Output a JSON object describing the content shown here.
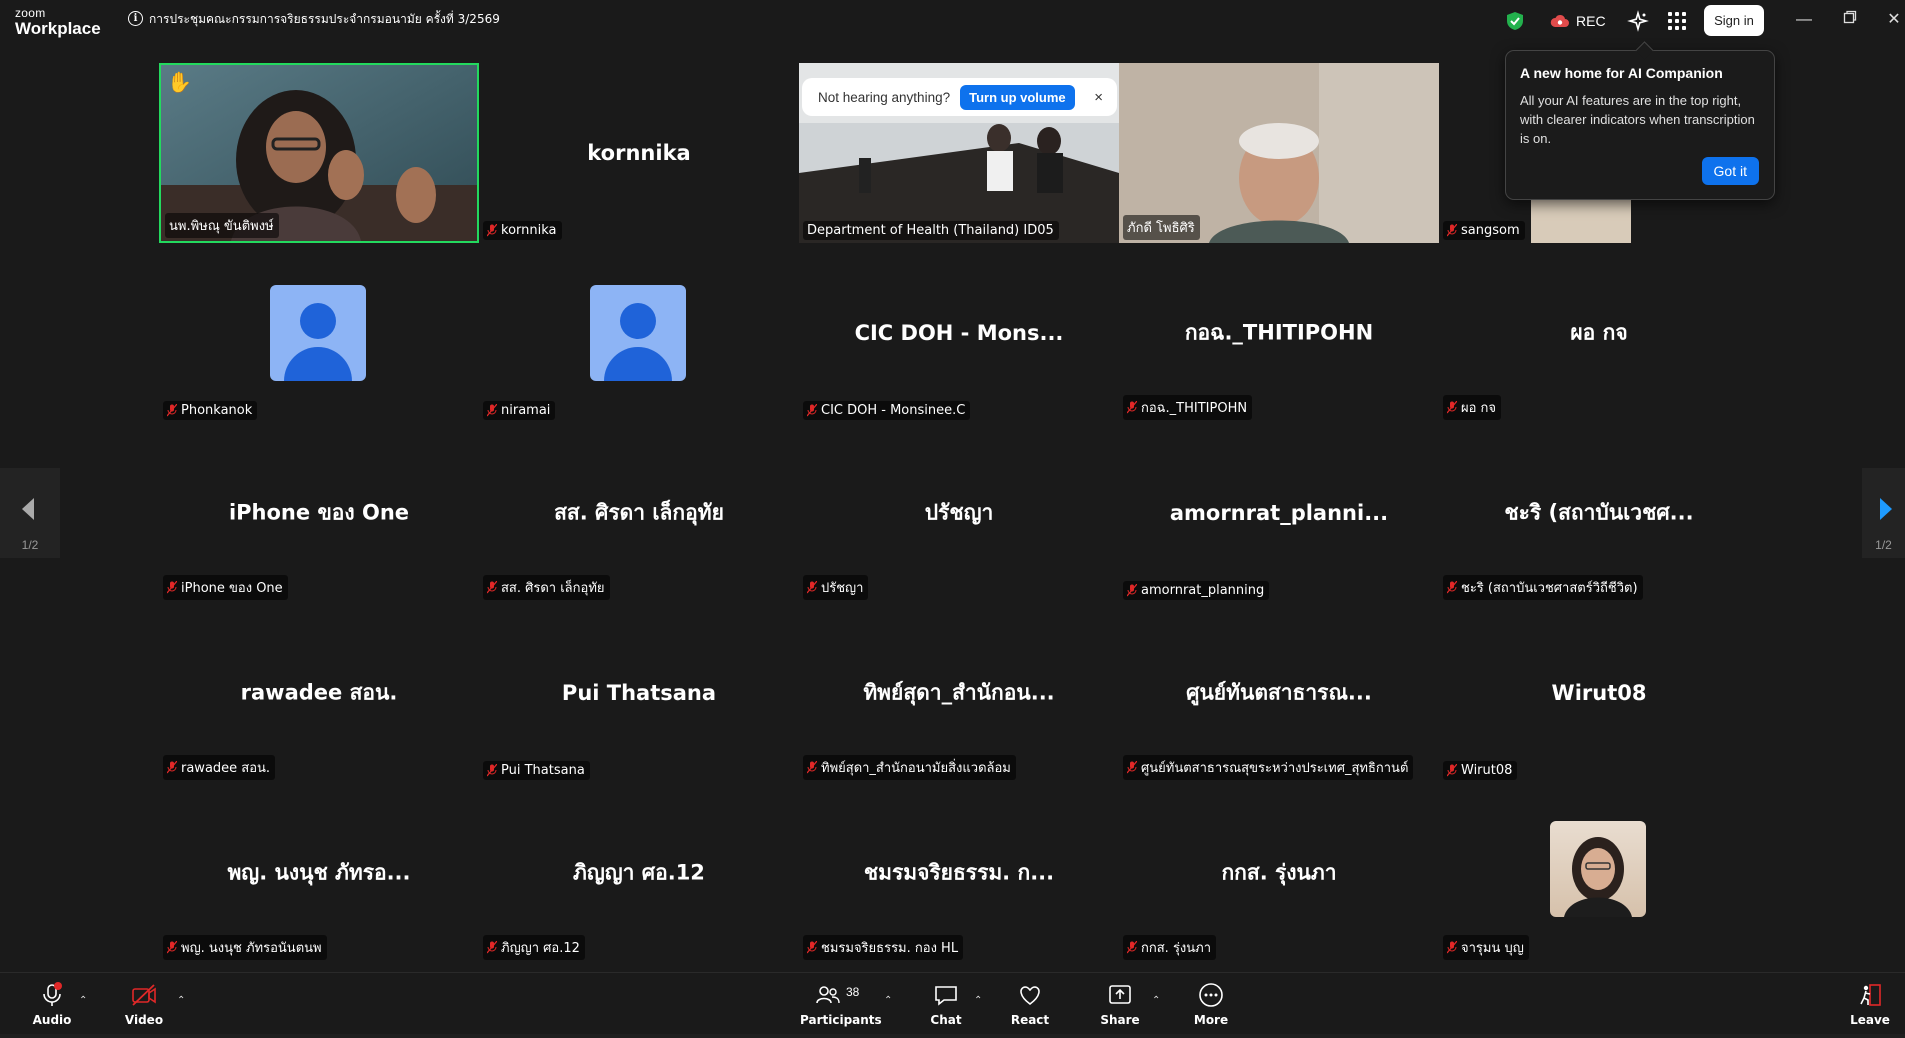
{
  "app": {
    "logo_top": "zoom",
    "logo_bottom": "Workplace",
    "meeting_title": "การประชุมคณะกรรมการจริยธรรมประจำกรมอนามัย ครั้งที่ 3/2569",
    "rec_label": "REC",
    "sign_in": "Sign in"
  },
  "toast": {
    "message": "Not hearing anything?",
    "button": "Turn up volume",
    "close": "×"
  },
  "ai_popup": {
    "title": "A new home for AI Companion",
    "body": "All your AI features are in the top right, with clearer indicators when transcription is on.",
    "button": "Got it"
  },
  "pager": {
    "left_count": "1/2",
    "right_count": "1/2"
  },
  "tiles": [
    {
      "center": "",
      "label": "นพ.พิษณุ ขันติพงษ์",
      "muted": false
    },
    {
      "center": "kornnika",
      "label": "kornnika",
      "muted": true
    },
    {
      "center": "",
      "label": "Department of Health (Thailand) ID05",
      "muted": false
    },
    {
      "center": "",
      "label": "ภักดี โพธิศิริ",
      "muted": false
    },
    {
      "center": "",
      "label": "sangsom",
      "muted": true
    },
    {
      "center": "",
      "label": "Phonkanok",
      "muted": true
    },
    {
      "center": "",
      "label": "niramai",
      "muted": true
    },
    {
      "center": "CIC DOH - Mons...",
      "label": "CIC DOH - Monsinee.C",
      "muted": true
    },
    {
      "center": "กอฉ._THITIPOHN",
      "label": "กอฉ._THITIPOHN",
      "muted": true
    },
    {
      "center": "ผอ กจ",
      "label": "ผอ กจ",
      "muted": true
    },
    {
      "center": "iPhone ของ One",
      "label": "iPhone ของ One",
      "muted": true
    },
    {
      "center": "สส. ศิรดา เล็กอุทัย",
      "label": "สส. ศิรดา เล็กอุทัย",
      "muted": true
    },
    {
      "center": "ปรัชญา",
      "label": "ปรัชญา",
      "muted": true
    },
    {
      "center": "amornrat_planni...",
      "label": "amornrat_planning",
      "muted": true
    },
    {
      "center": "ชะริ (สถาบันเวชศ...",
      "label": "ชะริ (สถาบันเวชศาสตร์วิถีชีวิต)",
      "muted": true
    },
    {
      "center": "rawadee สอน.",
      "label": "rawadee สอน.",
      "muted": true
    },
    {
      "center": "Pui Thatsana",
      "label": "Pui Thatsana",
      "muted": true
    },
    {
      "center": "ทิพย์สุดา_สำนักอน...",
      "label": "ทิพย์สุดา_สำนักอนามัยสิ่งแวดล้อม",
      "muted": true
    },
    {
      "center": "ศูนย์ทันตสาธารณ...",
      "label": "ศูนย์ทันตสาธารณสุขระหว่างประเทศ_สุทธิกานต์",
      "muted": true
    },
    {
      "center": "Wirut08",
      "label": "Wirut08",
      "muted": true
    },
    {
      "center": "พญ. นงนุช ภัทรอ...",
      "label": "พญ. นงนุช ภัทรอนันตนพ",
      "muted": true
    },
    {
      "center": "ภิญญา ศอ.12",
      "label": "ภิญญา ศอ.12",
      "muted": true
    },
    {
      "center": "ชมรมจริยธรรม. ก...",
      "label": "ชมรมจริยธรรม. กอง HL",
      "muted": true
    },
    {
      "center": "กกส. รุ่งนภา",
      "label": "กกส. รุ่งนภา",
      "muted": true
    },
    {
      "center": "",
      "label": "จารุมน บุญ",
      "muted": true
    }
  ],
  "toolbar": {
    "audio": "Audio",
    "video": "Video",
    "participants": "Participants",
    "participants_count": "38",
    "chat": "Chat",
    "react": "React",
    "share": "Share",
    "more": "More",
    "leave": "Leave"
  },
  "colors": {
    "background": "#1a1a1a",
    "accent": "#0e72ed",
    "active_speaker": "#23d95e",
    "muted": "#e02828",
    "avatar_bg": "#8db4f5",
    "avatar_fg": "#1f63d9"
  }
}
